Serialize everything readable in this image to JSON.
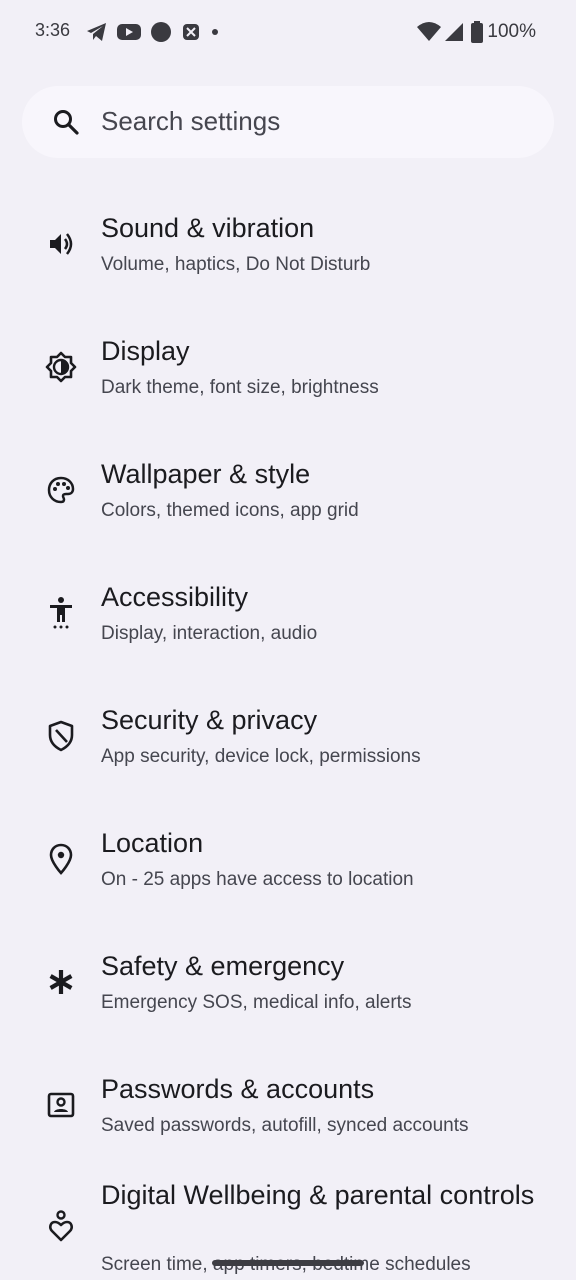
{
  "status_bar": {
    "time": "3:36",
    "left_icons": [
      "telegram-icon",
      "youtube-icon",
      "circle-app-icon",
      "crossed-app-icon",
      "dot-icon"
    ],
    "right_icons": [
      "wifi-icon",
      "signal-icon",
      "battery-icon"
    ],
    "battery": "100%"
  },
  "search": {
    "placeholder": "Search settings"
  },
  "settings": {
    "items": [
      {
        "title": "Sound & vibration",
        "subtitle": "Volume, haptics, Do Not Disturb",
        "icon": "speaker-icon"
      },
      {
        "title": "Display",
        "subtitle": "Dark theme, font size, brightness",
        "icon": "brightness-icon"
      },
      {
        "title": "Wallpaper & style",
        "subtitle": "Colors, themed icons, app grid",
        "icon": "palette-icon"
      },
      {
        "title": "Accessibility",
        "subtitle": "Display, interaction, audio",
        "icon": "accessibility-icon"
      },
      {
        "title": "Security & privacy",
        "subtitle": "App security, device lock, permissions",
        "icon": "shield-icon"
      },
      {
        "title": "Location",
        "subtitle": "On - 25 apps have access to location",
        "icon": "location-pin-icon"
      },
      {
        "title": "Safety & emergency",
        "subtitle": "Emergency SOS, medical info, alerts",
        "icon": "asterisk-icon"
      },
      {
        "title": "Passwords & accounts",
        "subtitle": "Saved passwords, autofill, synced accounts",
        "icon": "account-box-icon"
      },
      {
        "title": "Digital Wellbeing & parental controls",
        "subtitle": "Screen time, app timers, bedtime schedules",
        "icon": "wellbeing-icon"
      }
    ]
  },
  "colors": {
    "background": "#f2f0f7",
    "search_background": "#f8f6fc",
    "title_text": "#1b1b1f",
    "subtitle_text": "#45464f"
  }
}
